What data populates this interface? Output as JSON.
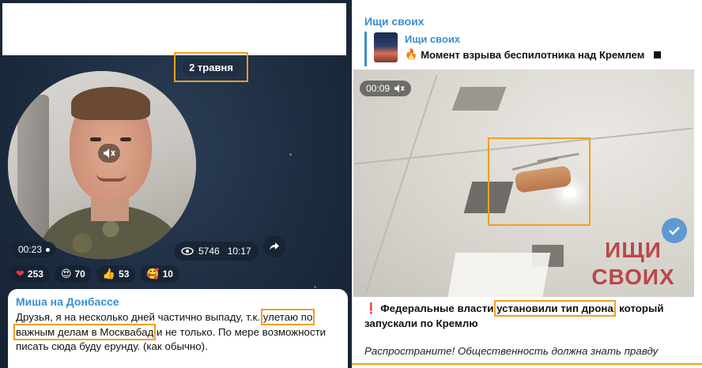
{
  "left": {
    "date_pill": "2 травня",
    "video_duration": "00:23",
    "views": "5746",
    "time": "10:17",
    "reactions": [
      {
        "icon": "heart",
        "glyph": "❤",
        "count": "253"
      },
      {
        "icon": "heart-eyes",
        "glyph": "😍",
        "count": "70"
      },
      {
        "icon": "thumbs-up",
        "glyph": "👍",
        "count": "53"
      },
      {
        "icon": "smile-hearts",
        "glyph": "🥰",
        "count": "10"
      }
    ],
    "message": {
      "sender": "Миша на Донбассе",
      "part1": "Друзья, я на несколько дней частично выпаду, т.к. ",
      "hl1": "улетаю по",
      "hl2": "важным делам в Москвабад",
      "part2": " и не только. По мере возможности писать сюда буду  ерунду. (как обычно)."
    }
  },
  "right": {
    "channel_title": "Ищи своих",
    "reply": {
      "channel": "Ищи своих",
      "text": "Момент взрыва беспилотника над Кремлем"
    },
    "video_timer": "00:09",
    "watermark_line1": "ИЩИ",
    "watermark_line2": "СВОИХ",
    "message": {
      "part1": "Федеральные власти ",
      "hl": "установили тип дрона",
      "part2": ", который запускали по Кремлю",
      "italic": "Распространите! Общественность должна знать правду"
    }
  },
  "colors": {
    "highlight": "#f0a020",
    "link_blue": "#3a8fd0",
    "dark_bg": "#1d2c40"
  }
}
